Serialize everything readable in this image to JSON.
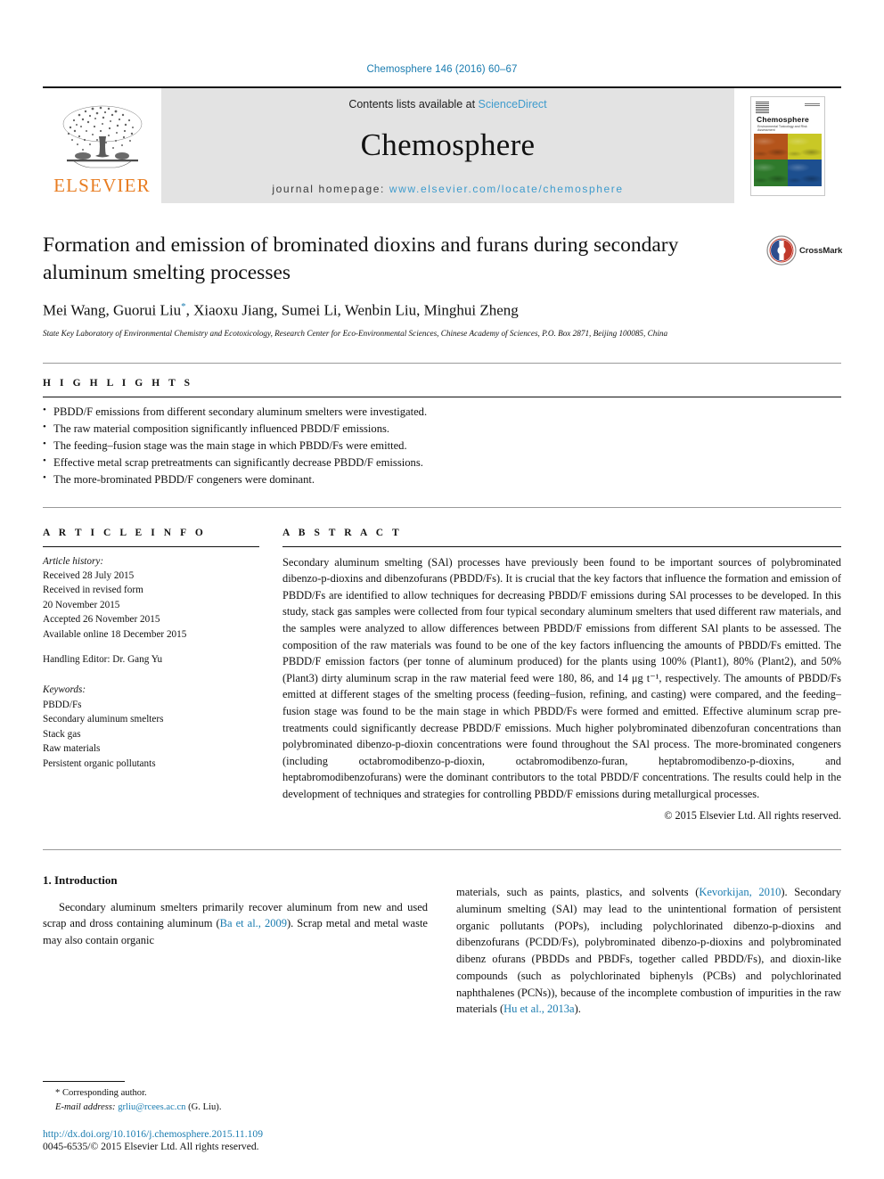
{
  "running_head": "Chemosphere 146 (2016) 60–67",
  "masthead": {
    "publisher_name": "ELSEVIER",
    "contents_prefix": "Contents lists available at",
    "contents_link": "ScienceDirect",
    "journal_name": "Chemosphere",
    "homepage_prefix": "journal homepage:",
    "homepage_url": "www.elsevier.com/locate/chemosphere",
    "cover": {
      "title": "Chemosphere",
      "subtitle": "Environmental Toxicology and Risk Assessment"
    }
  },
  "article": {
    "title": "Formation and emission of brominated dioxins and furans during secondary aluminum smelting processes",
    "authors": "Mei Wang, Guorui Liu",
    "author_marker": "*",
    "authors_rest": ", Xiaoxu Jiang, Sumei Li, Wenbin Liu, Minghui Zheng",
    "affiliation": "State Key Laboratory of Environmental Chemistry and Ecotoxicology, Research Center for Eco-Environmental Sciences, Chinese Academy of Sciences, P.O. Box 2871, Beijing 100085, China",
    "crossmark_label": "CrossMark"
  },
  "highlights": {
    "heading": "H I G H L I G H T S",
    "items": [
      "PBDD/F emissions from different secondary aluminum smelters were investigated.",
      "The raw material composition significantly influenced PBDD/F emissions.",
      "The feeding–fusion stage was the main stage in which PBDD/Fs were emitted.",
      "Effective metal scrap pretreatments can significantly decrease PBDD/F emissions.",
      "The more-brominated PBDD/F congeners were dominant."
    ]
  },
  "article_info": {
    "heading": "A R T I C L E I N F O",
    "history_label": "Article history:",
    "history": [
      "Received 28 July 2015",
      "Received in revised form",
      "20 November 2015",
      "Accepted 26 November 2015",
      "Available online 18 December 2015"
    ],
    "handling_editor": "Handling Editor: Dr. Gang Yu",
    "keywords_label": "Keywords:",
    "keywords": [
      "PBDD/Fs",
      "Secondary aluminum smelters",
      "Stack gas",
      "Raw materials",
      "Persistent organic pollutants"
    ]
  },
  "abstract": {
    "heading": "A B S T R A C T",
    "body": "Secondary aluminum smelting (SAl) processes have previously been found to be important sources of polybrominated dibenzo-p-dioxins and dibenzofurans (PBDD/Fs). It is crucial that the key factors that influence the formation and emission of PBDD/Fs are identified to allow techniques for decreasing PBDD/F emissions during SAl processes to be developed. In this study, stack gas samples were collected from four typical secondary aluminum smelters that used different raw materials, and the samples were analyzed to allow differences between PBDD/F emissions from different SAl plants to be assessed. The composition of the raw materials was found to be one of the key factors influencing the amounts of PBDD/Fs emitted. The PBDD/F emission factors (per tonne of aluminum produced) for the plants using 100% (Plant1), 80% (Plant2), and 50% (Plant3) dirty aluminum scrap in the raw material feed were 180, 86, and 14 μg t⁻¹, respectively. The amounts of PBDD/Fs emitted at different stages of the smelting process (feeding–fusion, refining, and casting) were compared, and the feeding–fusion stage was found to be the main stage in which PBDD/Fs were formed and emitted. Effective aluminum scrap pre-treatments could significantly decrease PBDD/F emissions. Much higher polybrominated dibenzofuran concentrations than polybrominated dibenzo-p-dioxin concentrations were found throughout the SAl process. The more-brominated congeners (including octabromodibenzo-p-dioxin, octabromodibenzo-furan, heptabromodibenzo-p-dioxins, and heptabromodibenzofurans) were the dominant contributors to the total PBDD/F concentrations. The results could help in the development of techniques and strategies for controlling PBDD/F emissions during metallurgical processes.",
    "copyright": "© 2015 Elsevier Ltd. All rights reserved."
  },
  "introduction": {
    "heading": "1. Introduction",
    "left_part1": "Secondary aluminum smelters primarily recover aluminum from new and used scrap and dross containing aluminum (",
    "left_cite1": "Ba et al., 2009",
    "left_part2": "). Scrap metal and metal waste may also contain organic",
    "right_part1": "materials, such as paints, plastics, and solvents (",
    "right_cite1": "Kevorkijan, 2010",
    "right_part2": "). Secondary aluminum smelting (SAl) may lead to the unintentional formation of persistent organic pollutants (POPs), including polychlorinated dibenzo-p-dioxins and dibenzofurans (PCDD/Fs), polybrominated dibenzo-p-dioxins and polybrominated dibenz ofurans (PBDDs and PBDFs, together called PBDD/Fs), and dioxin-like compounds (such as polychlorinated biphenyls (PCBs) and polychlorinated naphthalenes (PCNs)), because of the incomplete combustion of impurities in the raw materials (",
    "right_cite2": "Hu et al., 2013a",
    "right_part3": ")."
  },
  "footer": {
    "corresponding_marker": "*",
    "corresponding_label": "Corresponding author.",
    "email_label": "E-mail address:",
    "email": "grliu@rcees.ac.cn",
    "email_owner": "(G. Liu).",
    "doi": "http://dx.doi.org/10.1016/j.chemosphere.2015.11.109",
    "issn": "0045-6535/© 2015 Elsevier Ltd. All rights reserved."
  },
  "colors": {
    "link_blue": "#1a7cb0",
    "elsevier_orange": "#e87d22",
    "masthead_gray": "#e3e3e3"
  }
}
